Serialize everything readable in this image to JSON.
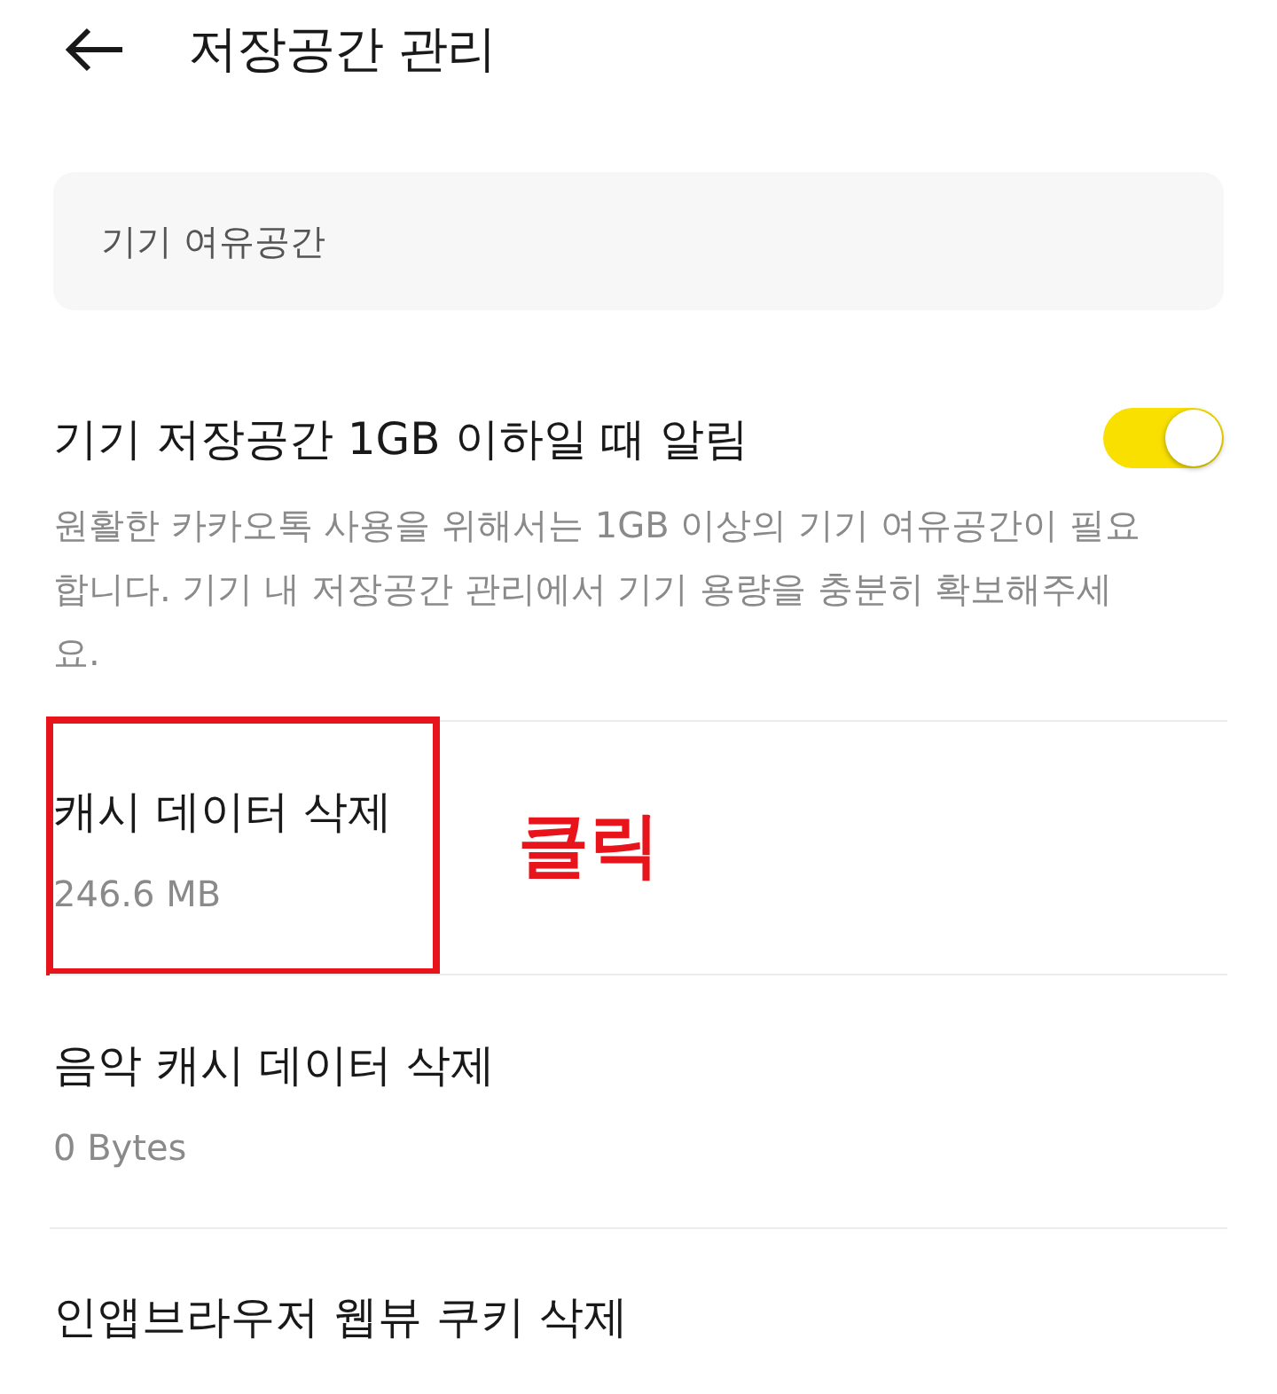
{
  "header": {
    "title": "저장공간 관리"
  },
  "section_card": {
    "label": "기기 여유공간"
  },
  "notification_setting": {
    "label": "기기 저장공간 1GB 이하일 때 알림",
    "on": true,
    "description": "원활한 카카오톡 사용을 위해서는 1GB 이상의 기기 여유공간이 필요합니다. 기기 내 저장공간 관리에서 기기 용량을 충분히 확보해주세요."
  },
  "items": [
    {
      "label": "캐시 데이터 삭제",
      "detail": "246.6 MB",
      "highlighted": true
    },
    {
      "label": "음악 캐시 데이터 삭제",
      "detail": "0 Bytes",
      "highlighted": false
    },
    {
      "label": "인앱브라우저 웹뷰 쿠키 삭제",
      "highlighted": false
    }
  ],
  "annotation": {
    "label": "클릭"
  }
}
